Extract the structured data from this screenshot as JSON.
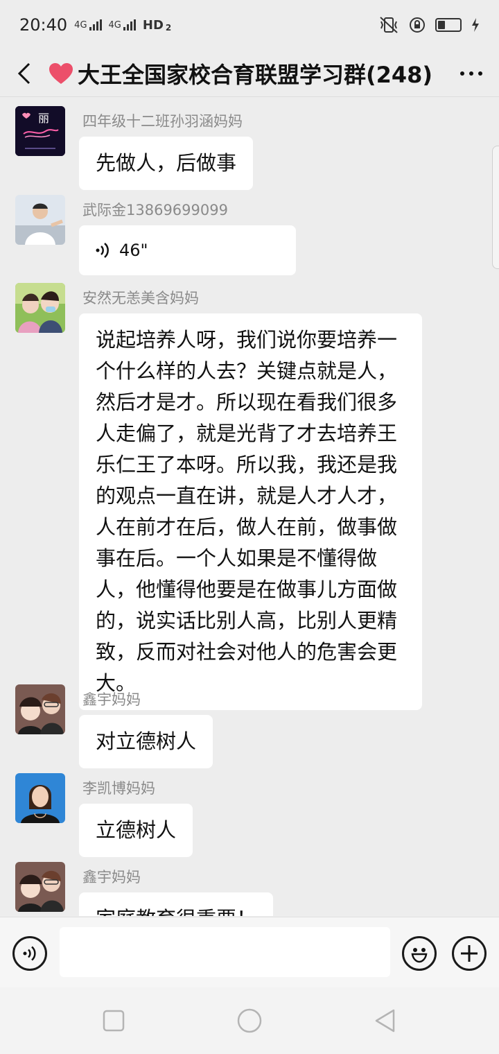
{
  "status_bar": {
    "time": "20:40",
    "net1": "4G",
    "net2": "4G",
    "hd": "HD",
    "hd_sub": "2"
  },
  "header": {
    "title": "大王全国家校合育联盟学习群(248)",
    "heart_color": "#ec4f6a"
  },
  "messages": [
    {
      "sender": "四年级十二班孙羽涵妈妈",
      "text": "先做人，后做事"
    },
    {
      "sender": "武际金13869699099",
      "voice_length": "46\""
    },
    {
      "sender": "安然无恙美含妈妈",
      "text": "说起培养人呀，我们说你要培养一个什么样的人去？关键点就是人，然后才是才。所以现在看我们很多人走偏了，就是光背了才去培养王乐仁王了本呀。所以我，我还是我的观点一直在讲，就是人才人才，人在前才在后，做人在前，做事做事在后。一个人如果是不懂得做人，他懂得他要是在做事儿方面做的，说实话比别人高，比别人更精致，反而对社会对他人的危害会更大。"
    },
    {
      "sender": "鑫宇妈妈",
      "text": "对立德树人"
    },
    {
      "sender": "李凯博妈妈",
      "text": "立德树人"
    },
    {
      "sender": "鑫宇妈妈",
      "text": "家庭教育很重要！"
    }
  ],
  "avatar1_text": "丽",
  "colors": {
    "background": "#ededed",
    "bubble": "#ffffff",
    "sender": "#8a8a8a"
  }
}
